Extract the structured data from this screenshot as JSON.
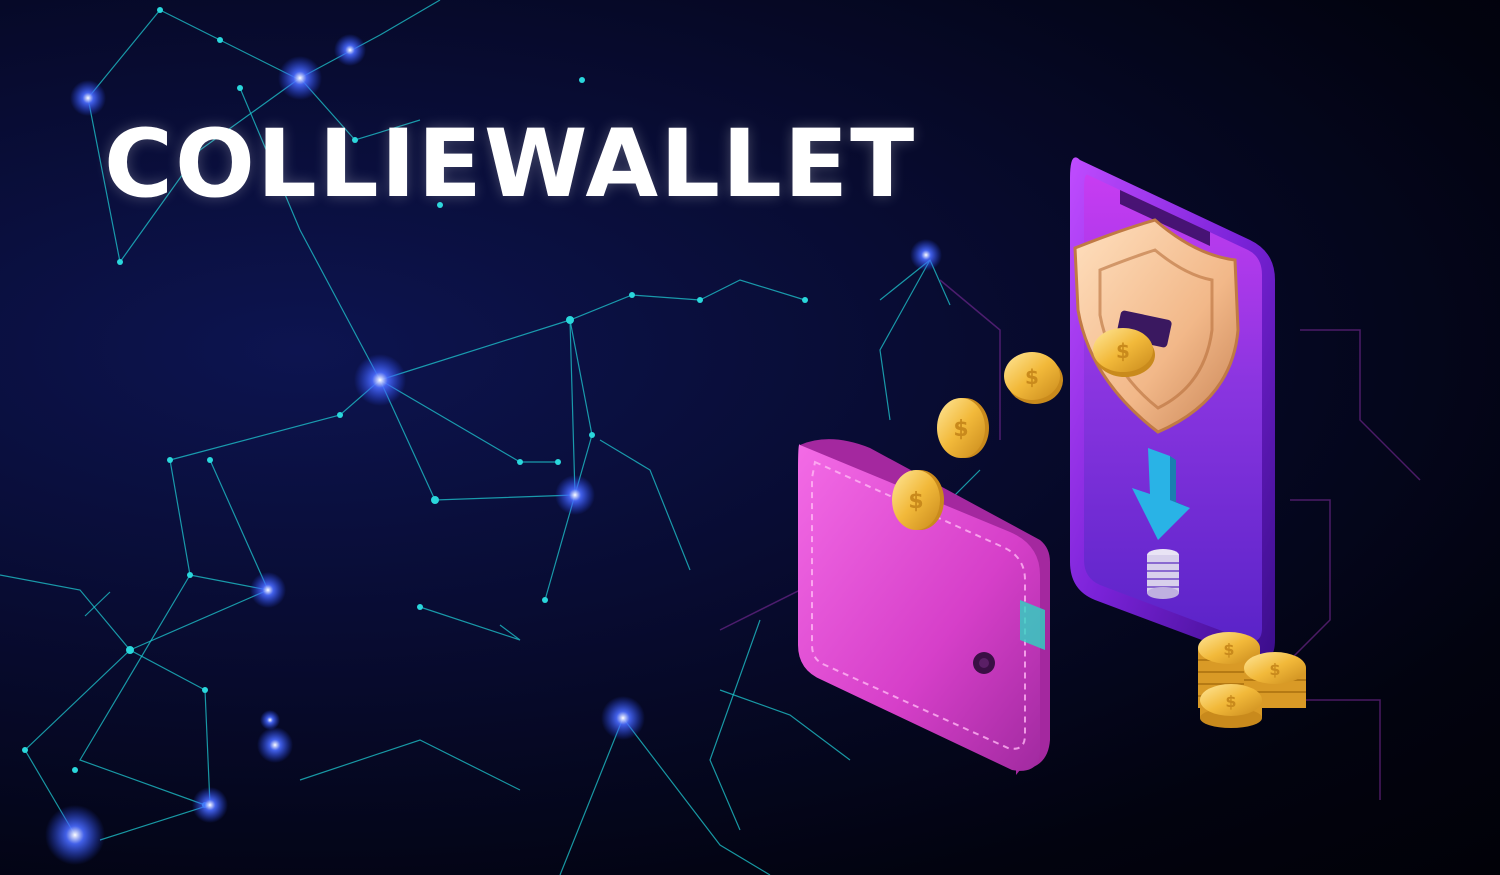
{
  "brand": {
    "title": "COLLIEWALLET"
  },
  "colors": {
    "background": "#050720",
    "network_line": "#1fc8d0",
    "network_glow": "#2a4dff",
    "wallet": "#e44bd6",
    "phone_frame": "#8a2be2",
    "phone_screen": "#7b2fd8",
    "shield": "#f6c39a",
    "arrow": "#29b3e6",
    "coin": "#f4c04a"
  },
  "icons": [
    "shield-icon",
    "download-arrow-icon",
    "coin-stack-icon",
    "wallet-icon",
    "smartphone-icon",
    "coin-icon"
  ]
}
